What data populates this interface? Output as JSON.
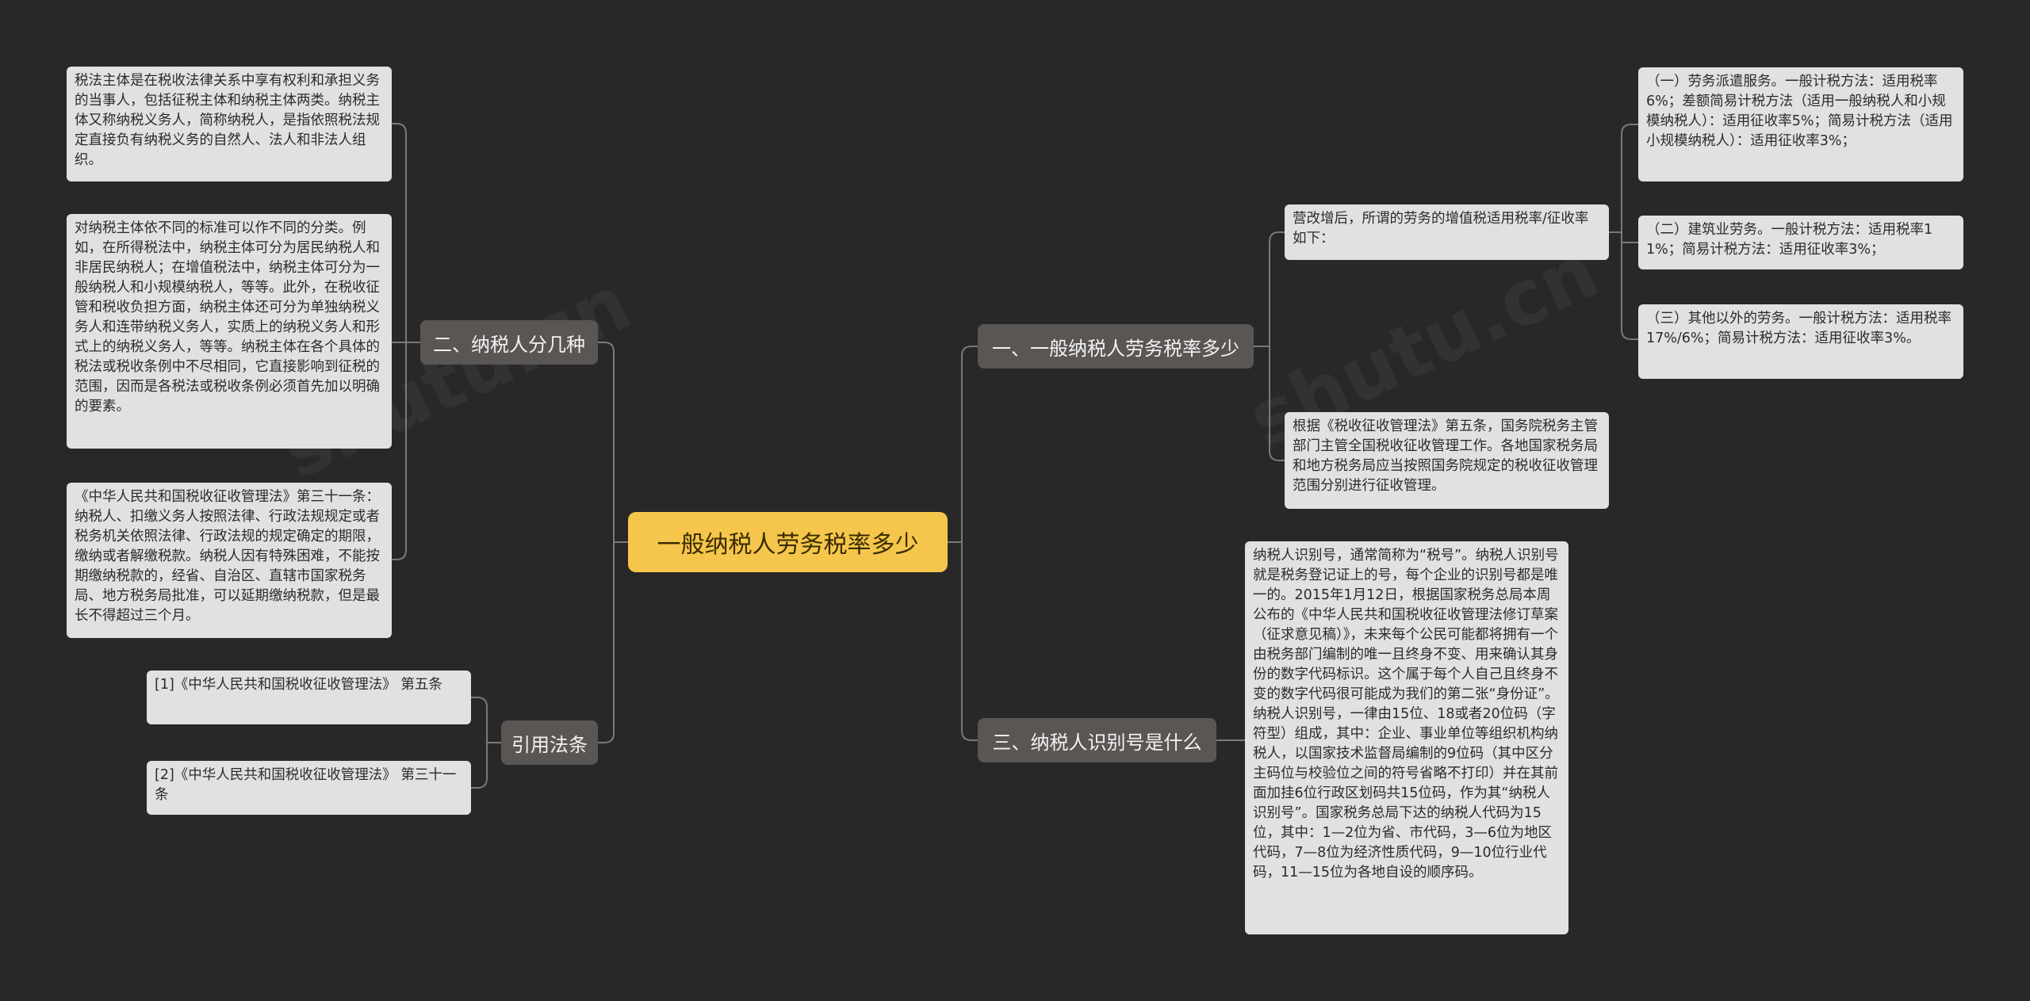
{
  "central": "一般纳税人劳务税率多少",
  "branches": {
    "b1": "一、一般纳税人劳务税率多少",
    "b2": "二、纳税人分几种",
    "b3": "三、纳税人识别号是什么",
    "b4": "引用法条"
  },
  "leaves": {
    "r1": "营改增后，所谓的劳务的增值税适用税率/征收率如下：",
    "r1a": "（一）劳务派遣服务。一般计税方法：适用税率6%；差额简易计税方法（适用一般纳税人和小规模纳税人）：适用征收率5%；简易计税方法（适用小规模纳税人）：适用征收率3%；",
    "r1b": "（二）建筑业劳务。一般计税方法：适用税率11%；简易计税方法：适用征收率3%；",
    "r1c": "（三）其他以外的劳务。一般计税方法：适用税率17%/6%；简易计税方法：适用征收率3%。",
    "r2": "根据《税收征收管理法》第五条，国务院税务主管部门主管全国税收征收管理工作。各地国家税务局和地方税务局应当按照国务院规定的税收征收管理范围分别进行征收管理。",
    "r3": "纳税人识别号，通常简称为“税号”。纳税人识别号就是税务登记证上的号，每个企业的识别号都是唯一的。2015年1月12日，根据国家税务总局本周公布的《中华人民共和国税收征收管理法修订草案（征求意见稿）》，未来每个公民可能都将拥有一个由税务部门编制的唯一且终身不变、用来确认其身份的数字代码标识。这个属于每个人自己且终身不变的数字代码很可能成为我们的第二张“身份证”。纳税人识别号，一律由15位、18或者20位码（字符型）组成，其中：企业、事业单位等组织机构纳税人，以国家技术监督局编制的9位码（其中区分主码位与校验位之间的符号省略不打印）并在其前面加挂6位行政区划码共15位码，作为其“纳税人识别号”。国家税务总局下达的纳税人代码为15位，其中：1—2位为省、市代码，3—6位为地区代码，7—8位为经济性质代码，9—10位行业代码，11—15位为各地自设的顺序码。",
    "l1": "税法主体是在税收法律关系中享有权利和承担义务的当事人，包括征税主体和纳税主体两类。纳税主体又称纳税义务人，简称纳税人，是指依照税法规定直接负有纳税义务的自然人、法人和非法人组织。",
    "l2": "对纳税主体依不同的标准可以作不同的分类。例如，在所得税法中，纳税主体可分为居民纳税人和非居民纳税人；在增值税法中，纳税主体可分为一般纳税人和小规模纳税人，等等。此外，在税收征管和税收负担方面，纳税主体还可分为单独纳税义务人和连带纳税义务人，实质上的纳税义务人和形式上的纳税义务人，等等。纳税主体在各个具体的税法或税收条例中不尽相同，它直接影响到征税的范围，因而是各税法或税收条例必须首先加以明确的要素。",
    "l3": "《中华人民共和国税收征收管理法》第三十一条：纳税人、扣缴义务人按照法律、行政法规规定或者税务机关依照法律、行政法规的规定确定的期限，缴纳或者解缴税款。纳税人因有特殊困难，不能按期缴纳税款的，经省、自治区、直辖市国家税务局、地方税务局批准，可以延期缴纳税款，但是最长不得超过三个月。",
    "c1": "[1]《中华人民共和国税收征收管理法》 第五条",
    "c2": "[2]《中华人民共和国税收征收管理法》 第三十一条"
  },
  "colors": {
    "background": "#282828",
    "central": "#f5c64b",
    "branch": "#5a5654",
    "leaf": "#e2e1df",
    "line": "#7a7a7a"
  }
}
